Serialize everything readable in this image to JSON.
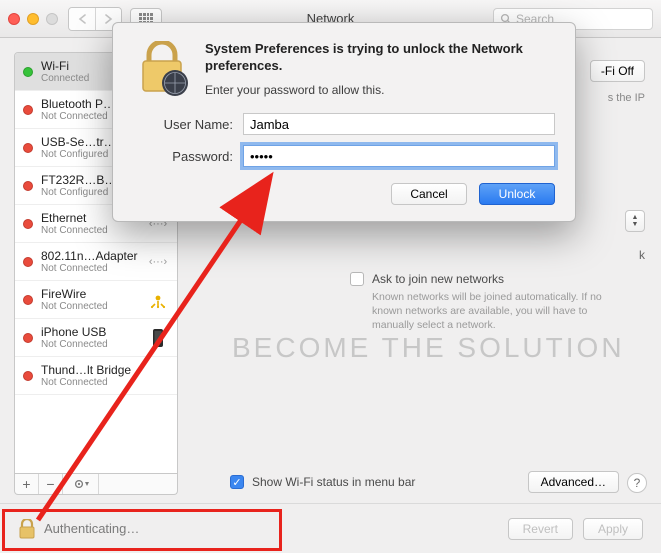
{
  "window": {
    "title": "Network",
    "search_placeholder": "Search"
  },
  "sidebar": {
    "items": [
      {
        "name": "Wi-Fi",
        "status_label": "Connected",
        "status": "green"
      },
      {
        "name": "Bluetooth P…",
        "status_label": "Not Connected",
        "status": "red"
      },
      {
        "name": "USB-Se…tr…",
        "status_label": "Not Configured",
        "status": "red"
      },
      {
        "name": "FT232R…B…",
        "status_label": "Not Configured",
        "status": "red"
      },
      {
        "name": "Ethernet",
        "status_label": "Not Connected",
        "status": "red"
      },
      {
        "name": "802.11n…Adapter",
        "status_label": "Not Connected",
        "status": "red"
      },
      {
        "name": "FireWire",
        "status_label": "Not Connected",
        "status": "red"
      },
      {
        "name": "iPhone USB",
        "status_label": "Not Connected",
        "status": "red"
      },
      {
        "name": "Thund…lt Bridge",
        "status_label": "Not Connected",
        "status": "red"
      }
    ]
  },
  "content": {
    "wifi_toggle": "-Fi Off",
    "ip_hint": "s the IP",
    "network_label_right": "k",
    "ask_join": "Ask to join new networks",
    "known_text": "Known networks will be joined automatically. If no known networks are available, you will have to manually select a network.",
    "show_menubar": "Show Wi-Fi status in menu bar",
    "advanced": "Advanced…"
  },
  "footer": {
    "lock_text": "Authenticating…",
    "revert": "Revert",
    "apply": "Apply"
  },
  "dialog": {
    "heading": "System Preferences is trying to unlock the Network preferences.",
    "subheading": "Enter your password to allow this.",
    "username_label": "User Name:",
    "username_value": "Jamba",
    "password_label": "Password:",
    "password_value": "•••••",
    "cancel": "Cancel",
    "unlock": "Unlock"
  },
  "watermark": "BECOME THE SOLUTION"
}
